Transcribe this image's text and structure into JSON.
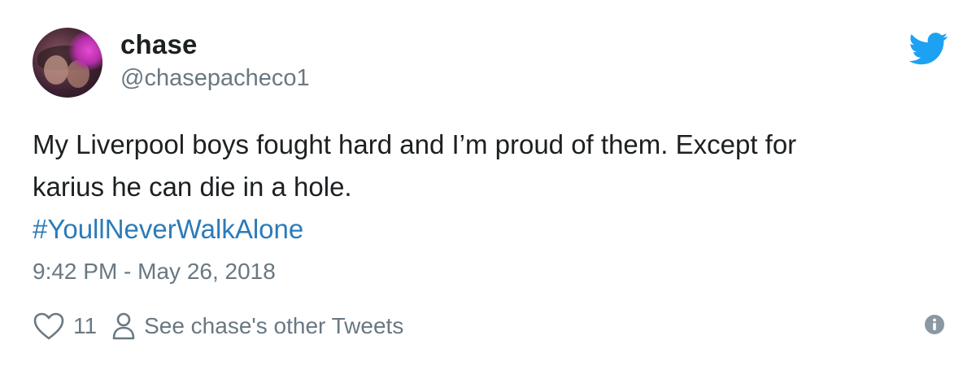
{
  "author": {
    "name": "chase",
    "handle": "@chasepacheco1",
    "avatar_icon": "profile-photo"
  },
  "tweet": {
    "text_lines": [
      "My Liverpool boys fought hard and I’m proud of them. Except for",
      "karius he can die in a hole."
    ],
    "hashtag": "#YoullNeverWalkAlone",
    "timestamp": "9:42 PM - May 26, 2018"
  },
  "actions": {
    "like_count": "11",
    "other_tweets_label": "See chase's other Tweets"
  },
  "icons": {
    "brand": "twitter-bird-icon",
    "like": "heart-icon",
    "person": "person-icon",
    "info": "info-icon"
  },
  "colors": {
    "brand_blue": "#1da1f2",
    "link_blue": "#2b7bb9",
    "text": "#1c2022",
    "muted": "#697882"
  }
}
